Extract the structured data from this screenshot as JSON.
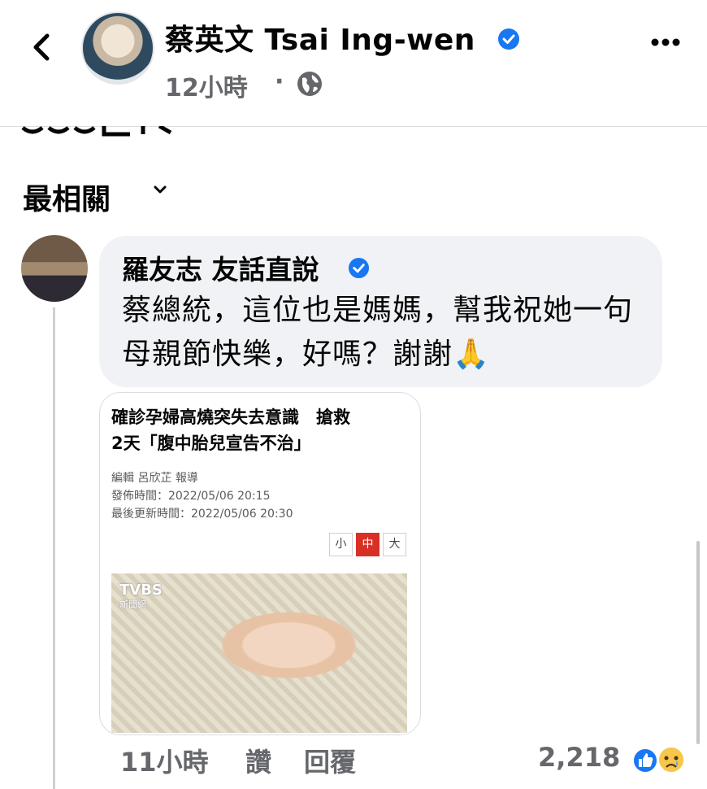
{
  "header": {
    "page_name": "蔡英文 Tsai Ing-wen",
    "time": "12小時",
    "separator": "·",
    "back_icon": "chevron-left-icon",
    "more_icon": "more-horizontal-icon",
    "privacy_icon": "globe-icon"
  },
  "sort": {
    "label": "最相關"
  },
  "comment": {
    "author": "羅友志 友話直說",
    "text": "蔡總統，這位也是媽媽，幫我祝她一句母親節快樂，好嗎？謝謝🙏",
    "time": "11小時",
    "like_label": "讚",
    "reply_label": "回覆",
    "reaction_count": "2,218",
    "reactions": [
      "like",
      "sad"
    ]
  },
  "article_card": {
    "headline_line1": "確診孕婦高燒突失去意識　搶救",
    "headline_line2": "2天「腹中胎兒宣告不治」",
    "editor": "編輯 呂欣芷 報導",
    "published": "發佈時間：2022/05/06 20:15",
    "updated": "最後更新時間：2022/05/06 20:30",
    "font_sizes": [
      "小",
      "中",
      "大"
    ],
    "logo": "TVBS",
    "logo_sub": "新聞網"
  },
  "colors": {
    "accent": "#1877f2",
    "meta_text": "#65676b",
    "bubble_bg": "#f0f2f5",
    "active_size": "#d93025"
  }
}
